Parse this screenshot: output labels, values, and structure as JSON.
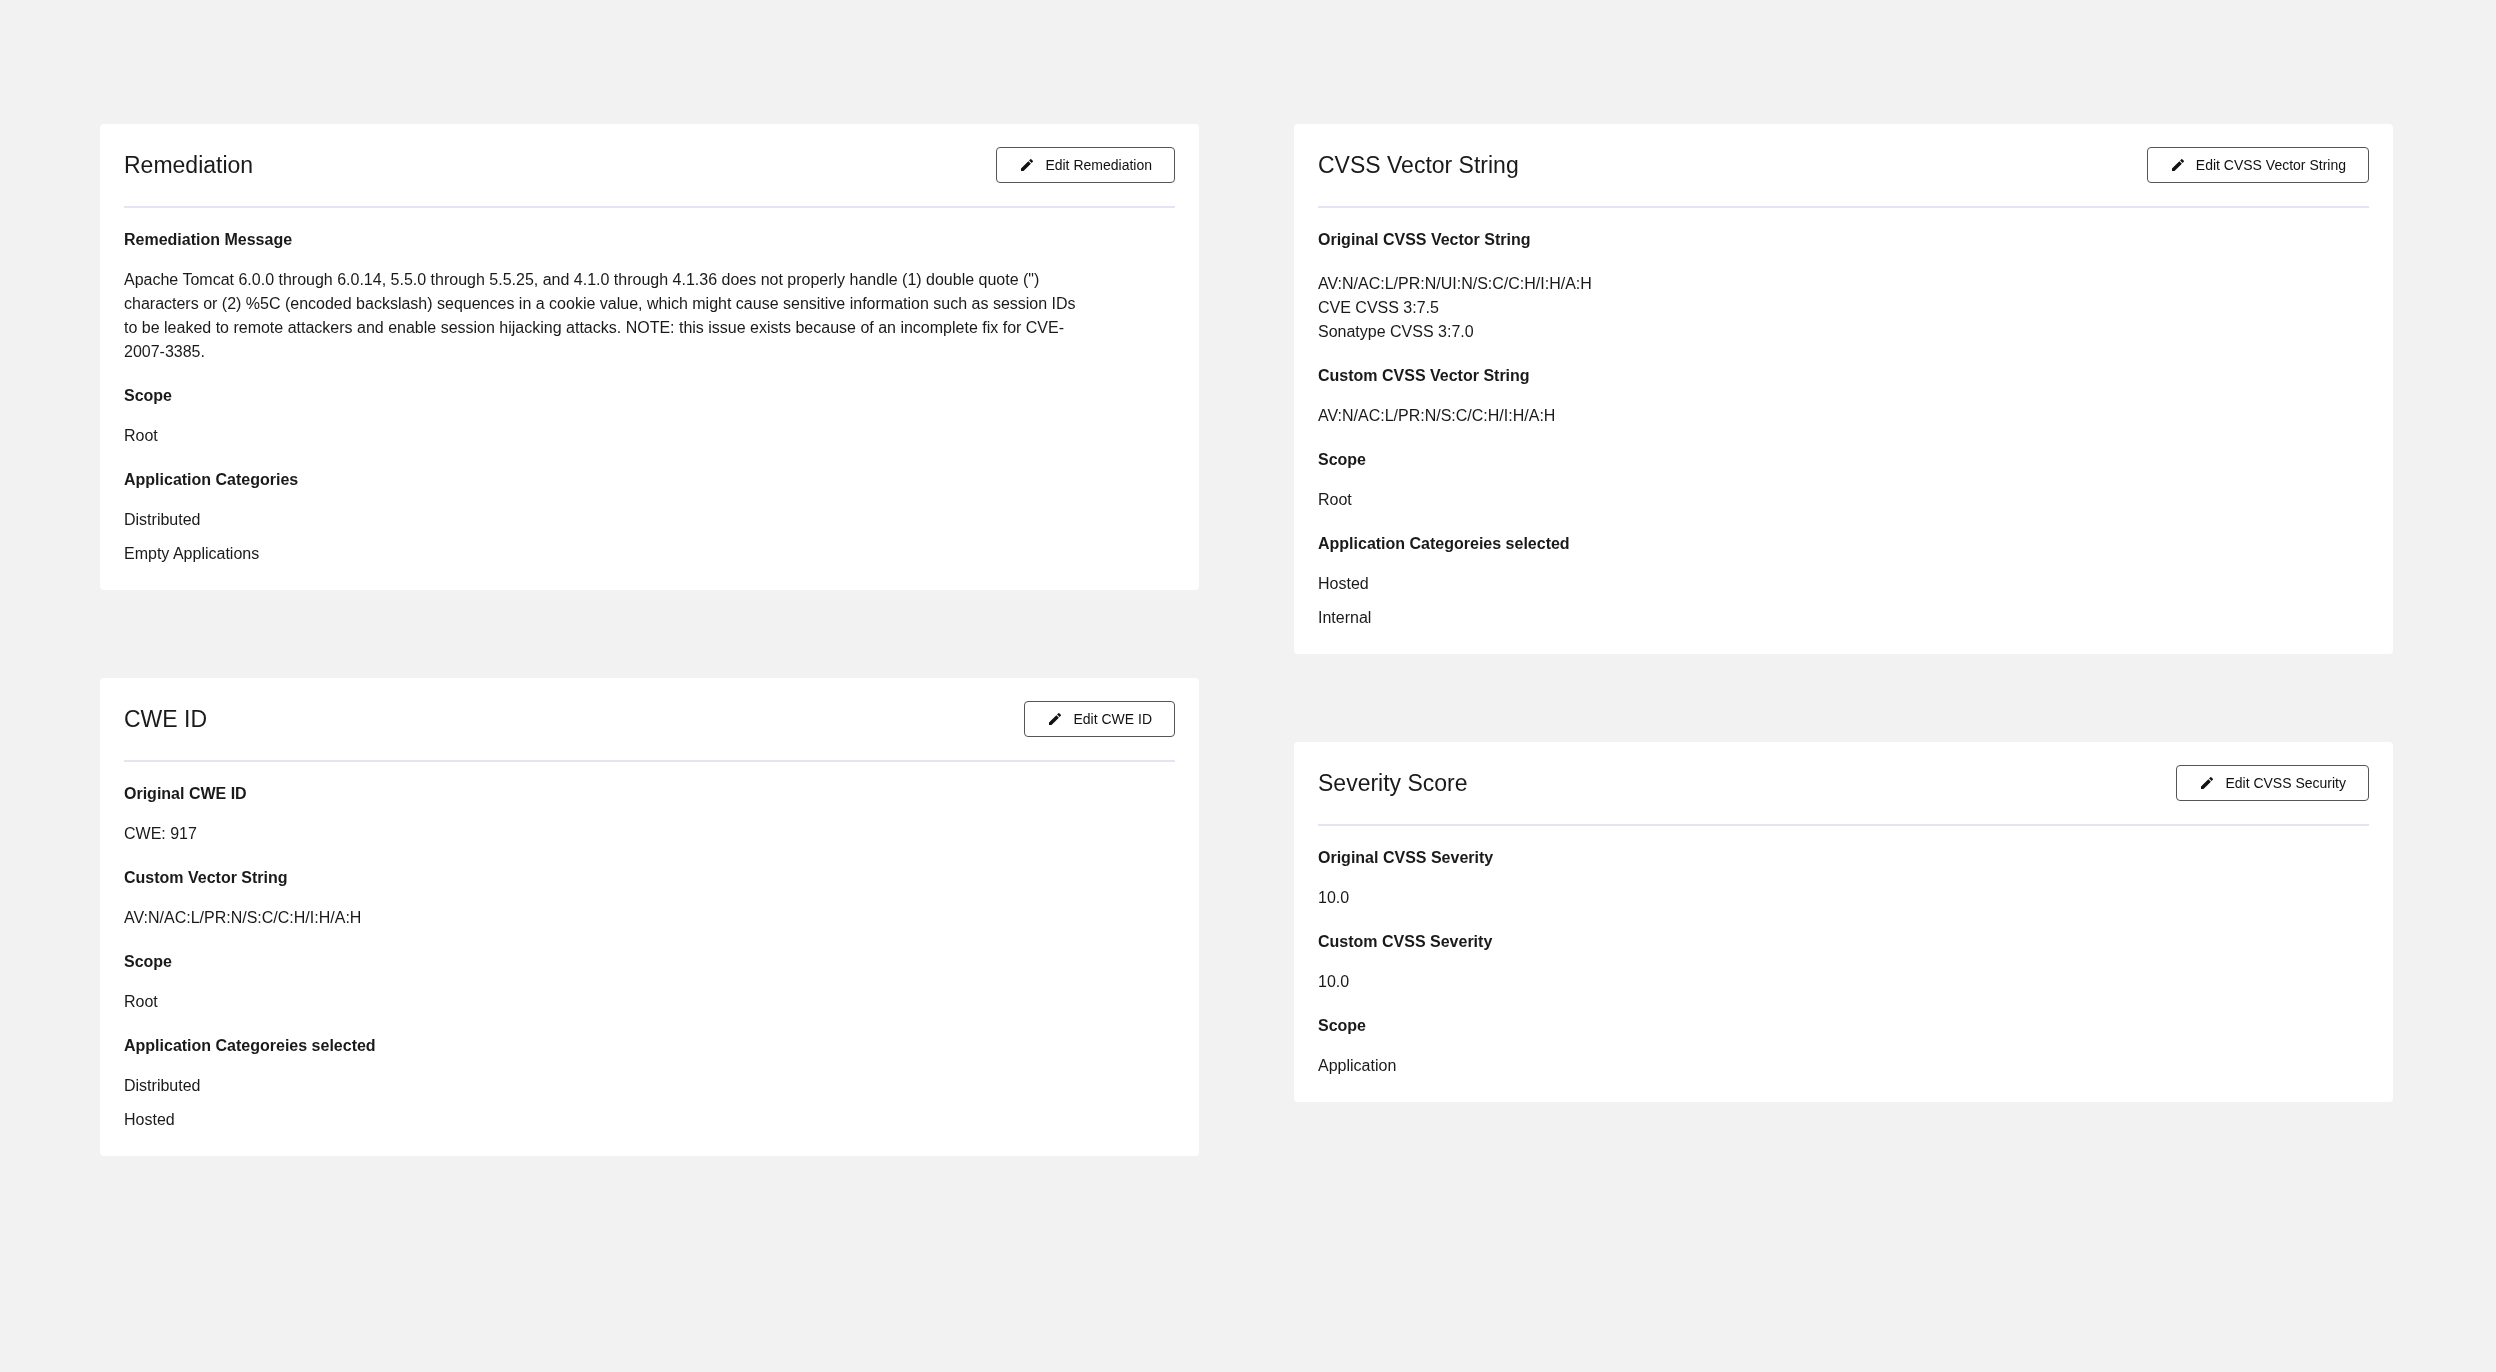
{
  "columns": [
    {
      "cards": [
        {
          "title": "Remediation",
          "button": "Edit Remediation",
          "sections": [
            {
              "label": "Remediation Message",
              "kind": "paragraph",
              "values": [
                "Apache Tomcat 6.0.0 through 6.0.14, 5.5.0 through 5.5.25, and 4.1.0 through 4.1.36 does not properly handle (1) double quote (\") characters or (2) %5C (encoded backslash) sequences in a cookie value, which might cause sensitive information such as session IDs to be leaked to remote attackers and enable session hijacking attacks. NOTE: this issue exists because of an incomplete fix for CVE-2007-3385."
              ]
            },
            {
              "label": "Scope",
              "kind": "list",
              "values": [
                "Root"
              ]
            },
            {
              "label": "Application Categories",
              "kind": "list",
              "values": [
                "Distributed",
                "Empty Applications"
              ]
            }
          ]
        },
        {
          "title": "CWE ID",
          "button": "Edit CWE ID",
          "sections": [
            {
              "label": "Original CWE ID",
              "kind": "list",
              "values": [
                "CWE: 917"
              ]
            },
            {
              "label": "Custom Vector String",
              "kind": "list",
              "values": [
                "AV:N/AC:L/PR:N/S:C/C:H/I:H/A:H"
              ]
            },
            {
              "label": "Scope",
              "kind": "list",
              "values": [
                "Root"
              ]
            },
            {
              "label": "Application Categoreies selected",
              "kind": "list",
              "values": [
                "Distributed",
                "Hosted"
              ]
            }
          ]
        }
      ]
    },
    {
      "cards": [
        {
          "title": "CVSS Vector String",
          "button": "Edit CVSS Vector String",
          "sections": [
            {
              "label": "Original CVSS Vector String",
              "kind": "block",
              "values": [
                "AV:N/AC:L/PR:N/UI:N/S:C/C:H/I:H/A:H",
                "CVE CVSS 3:7.5",
                "Sonatype CVSS 3:7.0"
              ]
            },
            {
              "label": "Custom CVSS Vector String",
              "kind": "list",
              "values": [
                "AV:N/AC:L/PR:N/S:C/C:H/I:H/A:H"
              ]
            },
            {
              "label": "Scope",
              "kind": "list",
              "values": [
                "Root"
              ]
            },
            {
              "label": "Application Categoreies selected",
              "kind": "list",
              "values": [
                "Hosted",
                "Internal"
              ]
            }
          ]
        },
        {
          "title": "Severity Score",
          "button": "Edit CVSS Security",
          "sections": [
            {
              "label": "Original CVSS Severity",
              "kind": "list",
              "values": [
                "10.0"
              ]
            },
            {
              "label": "Custom CVSS Severity",
              "kind": "list",
              "values": [
                "10.0"
              ]
            },
            {
              "label": "Scope",
              "kind": "list",
              "values": [
                "Application"
              ]
            }
          ]
        }
      ]
    }
  ]
}
